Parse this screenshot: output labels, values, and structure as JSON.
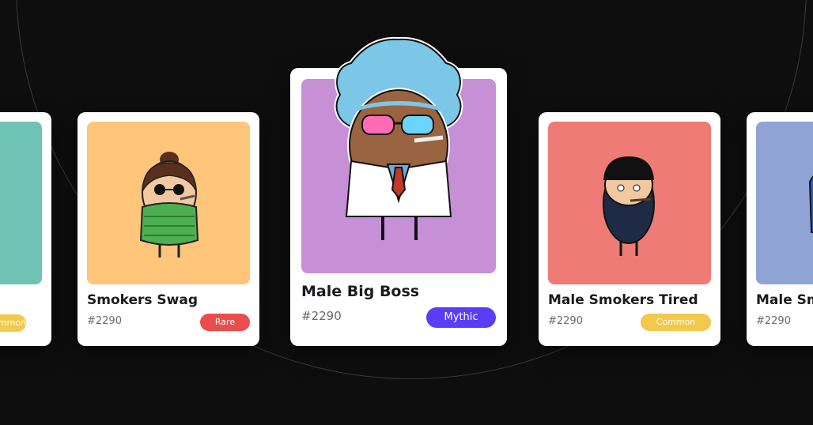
{
  "cards": [
    {
      "title": "",
      "id": "",
      "rarity": "Common",
      "art_color": "#6ec3b5",
      "rarity_color": "#f2c94c"
    },
    {
      "title": "Smokers Swag",
      "id": "#2290",
      "rarity": "Rare",
      "art_color": "#ffc57a",
      "rarity_color": "#eb4d4d"
    },
    {
      "title": "Male Big Boss",
      "id": "#2290",
      "rarity": "Mythic",
      "art_color": "#c78fd6",
      "rarity_color": "#5b3df5"
    },
    {
      "title": "Male Smokers Tired",
      "id": "#2290",
      "rarity": "Common",
      "art_color": "#ee7b75",
      "rarity_color": "#f2c94c"
    },
    {
      "title": "Male Sm",
      "id": "#2290",
      "rarity": "",
      "art_color": "#8fa4d4",
      "rarity_color": "#f2c94c"
    }
  ]
}
